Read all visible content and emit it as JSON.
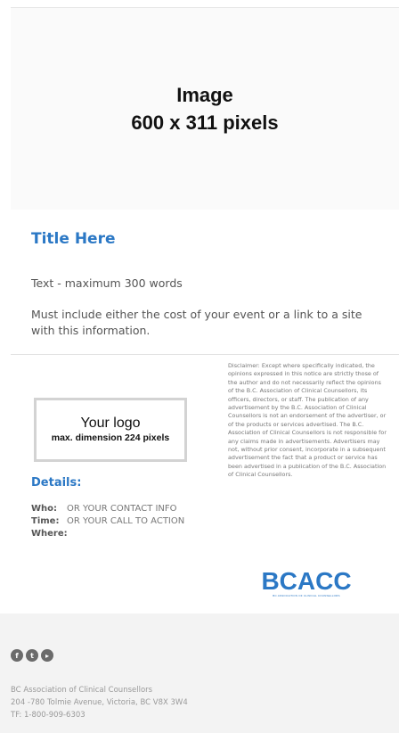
{
  "hero": {
    "line1": "Image",
    "line2": "600 x 311 pixels"
  },
  "article": {
    "title": "Title Here",
    "text1": "Text - maximum 300 words",
    "text2": "Must include either the cost of your event or a link to a site with this information."
  },
  "logo_placeholder": {
    "line1": "Your logo",
    "line2": "max. dimension 224 pixels"
  },
  "details": {
    "heading": "Details:",
    "rows": [
      {
        "label": "Who:",
        "value": "OR YOUR CONTACT INFO"
      },
      {
        "label": "Time:",
        "value": "OR YOUR CALL TO ACTION"
      },
      {
        "label": "Where:",
        "value": ""
      }
    ]
  },
  "disclaimer": "Disclaimer: Except where specifically indicated, the opinions expressed in this notice are strictly those of the author and do not necessarily reflect the opinions of the B.C. Association of Clinical Counsellors, its officers, directors, or staff. The publication of any advertisement by the B.C. Association of Clinical Counsellors is not an endorsement of the advertiser, or of the products or services advertised. The B.C. Association of Clinical Counsellors is not responsible for any claims made in advertisements. Advertisers may not, without prior consent, incorporate in a subsequent advertisement the fact that a product or service has been advertised in a publication of the B.C. Association of Clinical Counsellors.",
  "brand": {
    "name": "BCACC",
    "tagline": "BC ASSOCIATION OF CLINICAL COUNSELLORS",
    "color": "#2b78c5"
  },
  "footer": {
    "social": [
      {
        "icon": "facebook-icon",
        "glyph": "f"
      },
      {
        "icon": "twitter-icon",
        "glyph": "t"
      },
      {
        "icon": "youtube-icon",
        "glyph": "▸"
      }
    ],
    "address_line1": "BC Association of Clinical Counsellors",
    "address_line2": "204 -780 Tolmie Avenue, Victoria, BC V8X 3W4",
    "address_line3": "TF: 1-800-909-6303"
  }
}
